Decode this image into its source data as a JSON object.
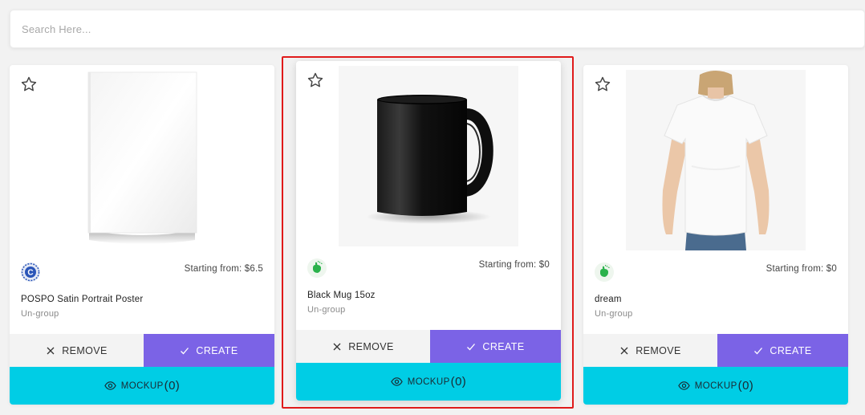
{
  "search": {
    "placeholder": "Search Here..."
  },
  "colors": {
    "create_bg": "#7b63e6",
    "mockup_bg": "#00cde5",
    "remove_bg": "#f3f3f3",
    "highlight_border": "#e01b1b"
  },
  "cards": [
    {
      "title": "POSPO Satin Portrait Poster",
      "group": "Un-group",
      "price": "Starting from: $6.5",
      "image": "poster-image",
      "brand_icon": "blue-c-brand-icon",
      "remove_label": "REMOVE",
      "create_label": "CREATE",
      "mockup_label": "MOCKUP",
      "mockup_count": "(0)"
    },
    {
      "title": "Black Mug 15oz",
      "group": "Un-group",
      "price": "Starting from: $0",
      "image": "black-mug-image",
      "brand_icon": "green-hand-brand-icon",
      "remove_label": "REMOVE",
      "create_label": "CREATE",
      "mockup_label": "MOCKUP",
      "mockup_count": "(0)",
      "highlighted": true
    },
    {
      "title": "dream",
      "group": "Un-group",
      "price": "Starting from: $0",
      "image": "white-tshirt-image",
      "brand_icon": "green-hand-brand-icon",
      "remove_label": "REMOVE",
      "create_label": "CREATE",
      "mockup_label": "MOCKUP",
      "mockup_count": "(0)"
    }
  ]
}
